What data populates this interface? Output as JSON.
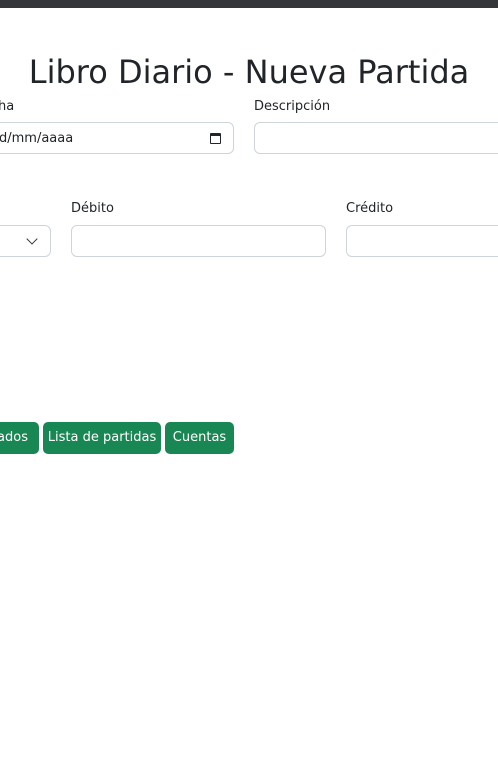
{
  "header": {
    "title": "Libro Diario - Nueva Partida"
  },
  "form": {
    "fecha_label": "ha",
    "fecha_value": "d/mm/aaaa",
    "descripcion_label": "Descripción",
    "descripcion_value": "",
    "debito_label": "Débito",
    "debito_value": "",
    "credito_label": "Crédito",
    "credito_value": ""
  },
  "actions": {
    "estados_label": "ados",
    "lista_label": "Lista de partidas",
    "cuentas_label": "Cuentas"
  },
  "colors": {
    "primary_button": "#198754",
    "top_bar": "#35363a",
    "input_border": "#ced4da"
  }
}
